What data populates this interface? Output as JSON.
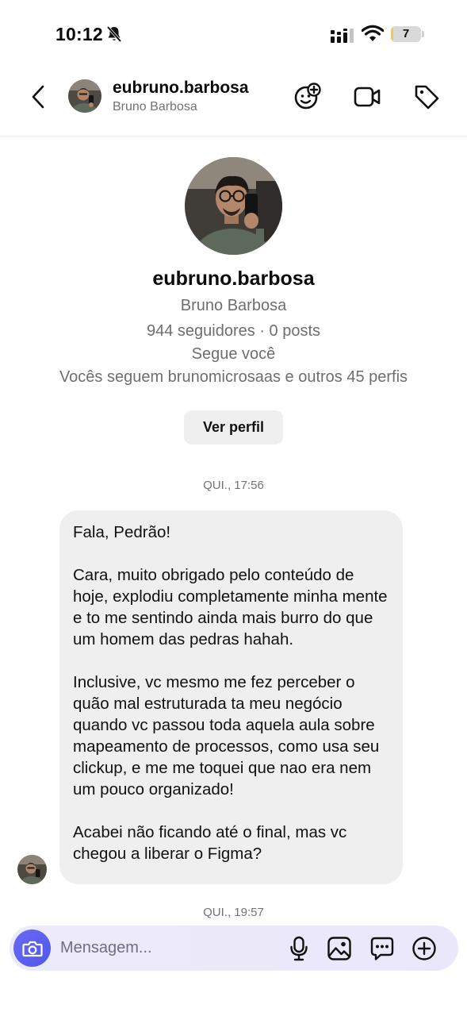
{
  "status_bar": {
    "time": "10:12",
    "battery_level": "7",
    "battery_fraction": 0.07,
    "icons": [
      "bell-muted-icon",
      "cellular-signal-icon",
      "wifi-icon",
      "battery-icon"
    ]
  },
  "header": {
    "username": "eubruno.barbosa",
    "full_name": "Bruno Barbosa",
    "icons": [
      "back-arrow-icon",
      "effects-icon",
      "video-call-icon",
      "tag-icon"
    ]
  },
  "profile": {
    "username": "eubruno.barbosa",
    "full_name": "Bruno Barbosa",
    "stats": "944 seguidores · 0 posts",
    "follows_you": "Segue você",
    "mutuals": "Vocês seguem brunomicrosaas e outros 45 perfis",
    "view_profile_label": "Ver perfil"
  },
  "conversation": {
    "timestamps": [
      "QUI., 17:56",
      "QUI., 19:57"
    ],
    "messages": [
      {
        "paragraphs": [
          "Fala, Pedrão!",
          "Cara, muito obrigado pelo conteúdo de hoje, explodiu completamente minha mente e to me sentindo ainda mais burro do que um homem das pedras hahah.",
          "Inclusive, vc mesmo me fez perceber o quão mal estruturada ta meu negócio quando vc passou toda aquela aula sobre mapeamento de processos, como usa seu clickup, e me me toquei que nao era nem um pouco organizado!",
          "Acabei não ficando até o final, mas vc chegou a liberar o Figma?"
        ]
      }
    ]
  },
  "composer": {
    "placeholder": "Mensagem...",
    "icons": [
      "camera-icon",
      "microphone-icon",
      "gallery-icon",
      "sticker-icon",
      "plus-icon"
    ]
  },
  "colors": {
    "accent": "#5b5ff0",
    "bubble": "#efefef",
    "composer": "#ecebfb",
    "secondary_text": "#737373"
  }
}
